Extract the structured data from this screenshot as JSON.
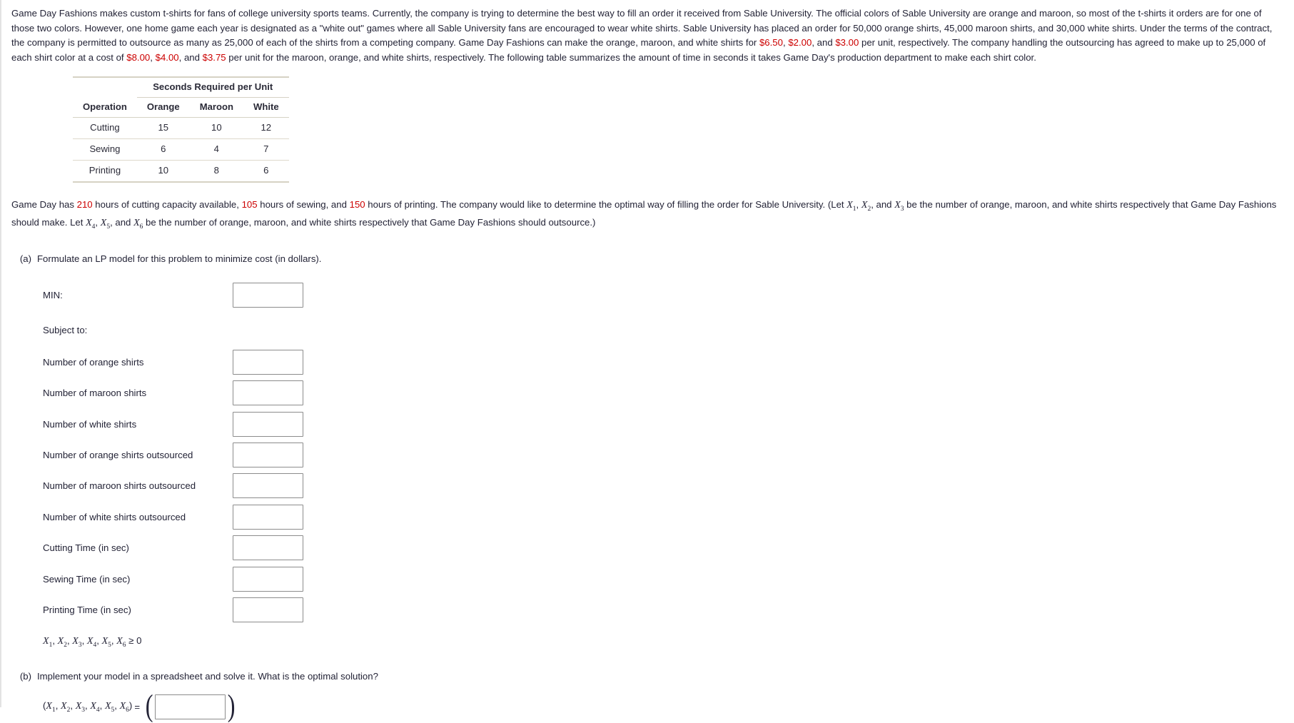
{
  "problem": {
    "intro_segments": [
      {
        "t": "Game Day Fashions makes custom t-shirts for fans of college university sports teams. Currently, the company is trying to determine the best way to fill an order it received from Sable University. The official colors of Sable University are orange and maroon, so most of the t-shirts it orders are for one of those two colors. However, one home game each year is designated as a \"white out\" games where all Sable University fans are encouraged to wear white shirts. Sable University has placed an order for 50,000 orange shirts, 45,000 maroon shirts, and 30,000 white shirts. Under the terms of the contract, the company is permitted to outsource as many as 25,000 of each of the shirts from a competing company. Game Day Fashions can make the orange, maroon, and white shirts for ",
        "red": false
      },
      {
        "t": "$6.50",
        "red": true
      },
      {
        "t": ", ",
        "red": false
      },
      {
        "t": "$2.00",
        "red": true
      },
      {
        "t": ", and ",
        "red": false
      },
      {
        "t": "$3.00",
        "red": true
      },
      {
        "t": " per unit, respectively. The company handling the outsourcing has agreed to make up to 25,000 of each shirt color at a cost of ",
        "red": false
      },
      {
        "t": "$8.00",
        "red": true
      },
      {
        "t": ", ",
        "red": false
      },
      {
        "t": "$4.00",
        "red": true
      },
      {
        "t": ", and ",
        "red": false
      },
      {
        "t": "$3.75",
        "red": true
      },
      {
        "t": " per unit for the maroon, orange, and white shirts, respectively. The following table summarizes the amount of time in seconds it takes Game Day's production department to make each shirt color.",
        "red": false
      }
    ]
  },
  "table": {
    "group_header": "Seconds Required per Unit",
    "columns": [
      "Operation",
      "Orange",
      "Maroon",
      "White"
    ],
    "rows": [
      {
        "operation": "Cutting",
        "orange": "15",
        "maroon": "10",
        "white": "12"
      },
      {
        "operation": "Sewing",
        "orange": "6",
        "maroon": "4",
        "white": "7"
      },
      {
        "operation": "Printing",
        "orange": "10",
        "maroon": "8",
        "white": "6"
      }
    ]
  },
  "capacity_paragraph": {
    "seg1": "Game Day has ",
    "cutting_hours": "210",
    "seg2": " hours of cutting capacity available, ",
    "sewing_hours": "105",
    "seg3": " hours of sewing, and ",
    "printing_hours": "150",
    "seg4": " hours of printing. The company would like to determine the optimal way of filling the order for Sable University. (Let ",
    "vars_make": [
      "X1",
      "X2",
      "X3"
    ],
    "seg5": " be the number of orange, maroon, and white shirts respectively that Game Day Fashions should make. Let ",
    "vars_outsource": [
      "X4",
      "X5",
      "X6"
    ],
    "seg6": " be the number of orange, maroon, and white shirts respectively that Game Day Fashions should outsource.)"
  },
  "part_a": {
    "label": "(a)",
    "text": "Formulate an LP model for this problem to minimize cost (in dollars).",
    "min_label": "MIN:",
    "min_value": "",
    "subject_to_label": "Subject to:",
    "constraints": [
      {
        "label": "Number of orange shirts",
        "value": ""
      },
      {
        "label": "Number of maroon shirts",
        "value": ""
      },
      {
        "label": "Number of white shirts",
        "value": ""
      },
      {
        "label": "Number of orange shirts outsourced",
        "value": ""
      },
      {
        "label": "Number of maroon shirts outsourced",
        "value": ""
      },
      {
        "label": "Number of white shirts outsourced",
        "value": ""
      },
      {
        "label": "Cutting Time (in sec)",
        "value": ""
      },
      {
        "label": "Sewing Time (in sec)",
        "value": ""
      },
      {
        "label": "Printing Time (in sec)",
        "value": ""
      }
    ],
    "nonnegativity": "X1, X2, X3, X4, X5, X6 ≥ 0"
  },
  "part_b": {
    "label": "(b)",
    "text": "Implement your model in a spreadsheet and solve it. What is the optimal solution?",
    "answer_prefix": "(X1, X2, X3, X4, X5, X6) =",
    "answer_value": "",
    "open_paren": "(",
    "close_paren": ")"
  },
  "colors": {
    "red_highlight": "#cc0000",
    "text": "#232336",
    "table_rule": "#d6d2c4",
    "input_border": "#8c8c8c"
  }
}
